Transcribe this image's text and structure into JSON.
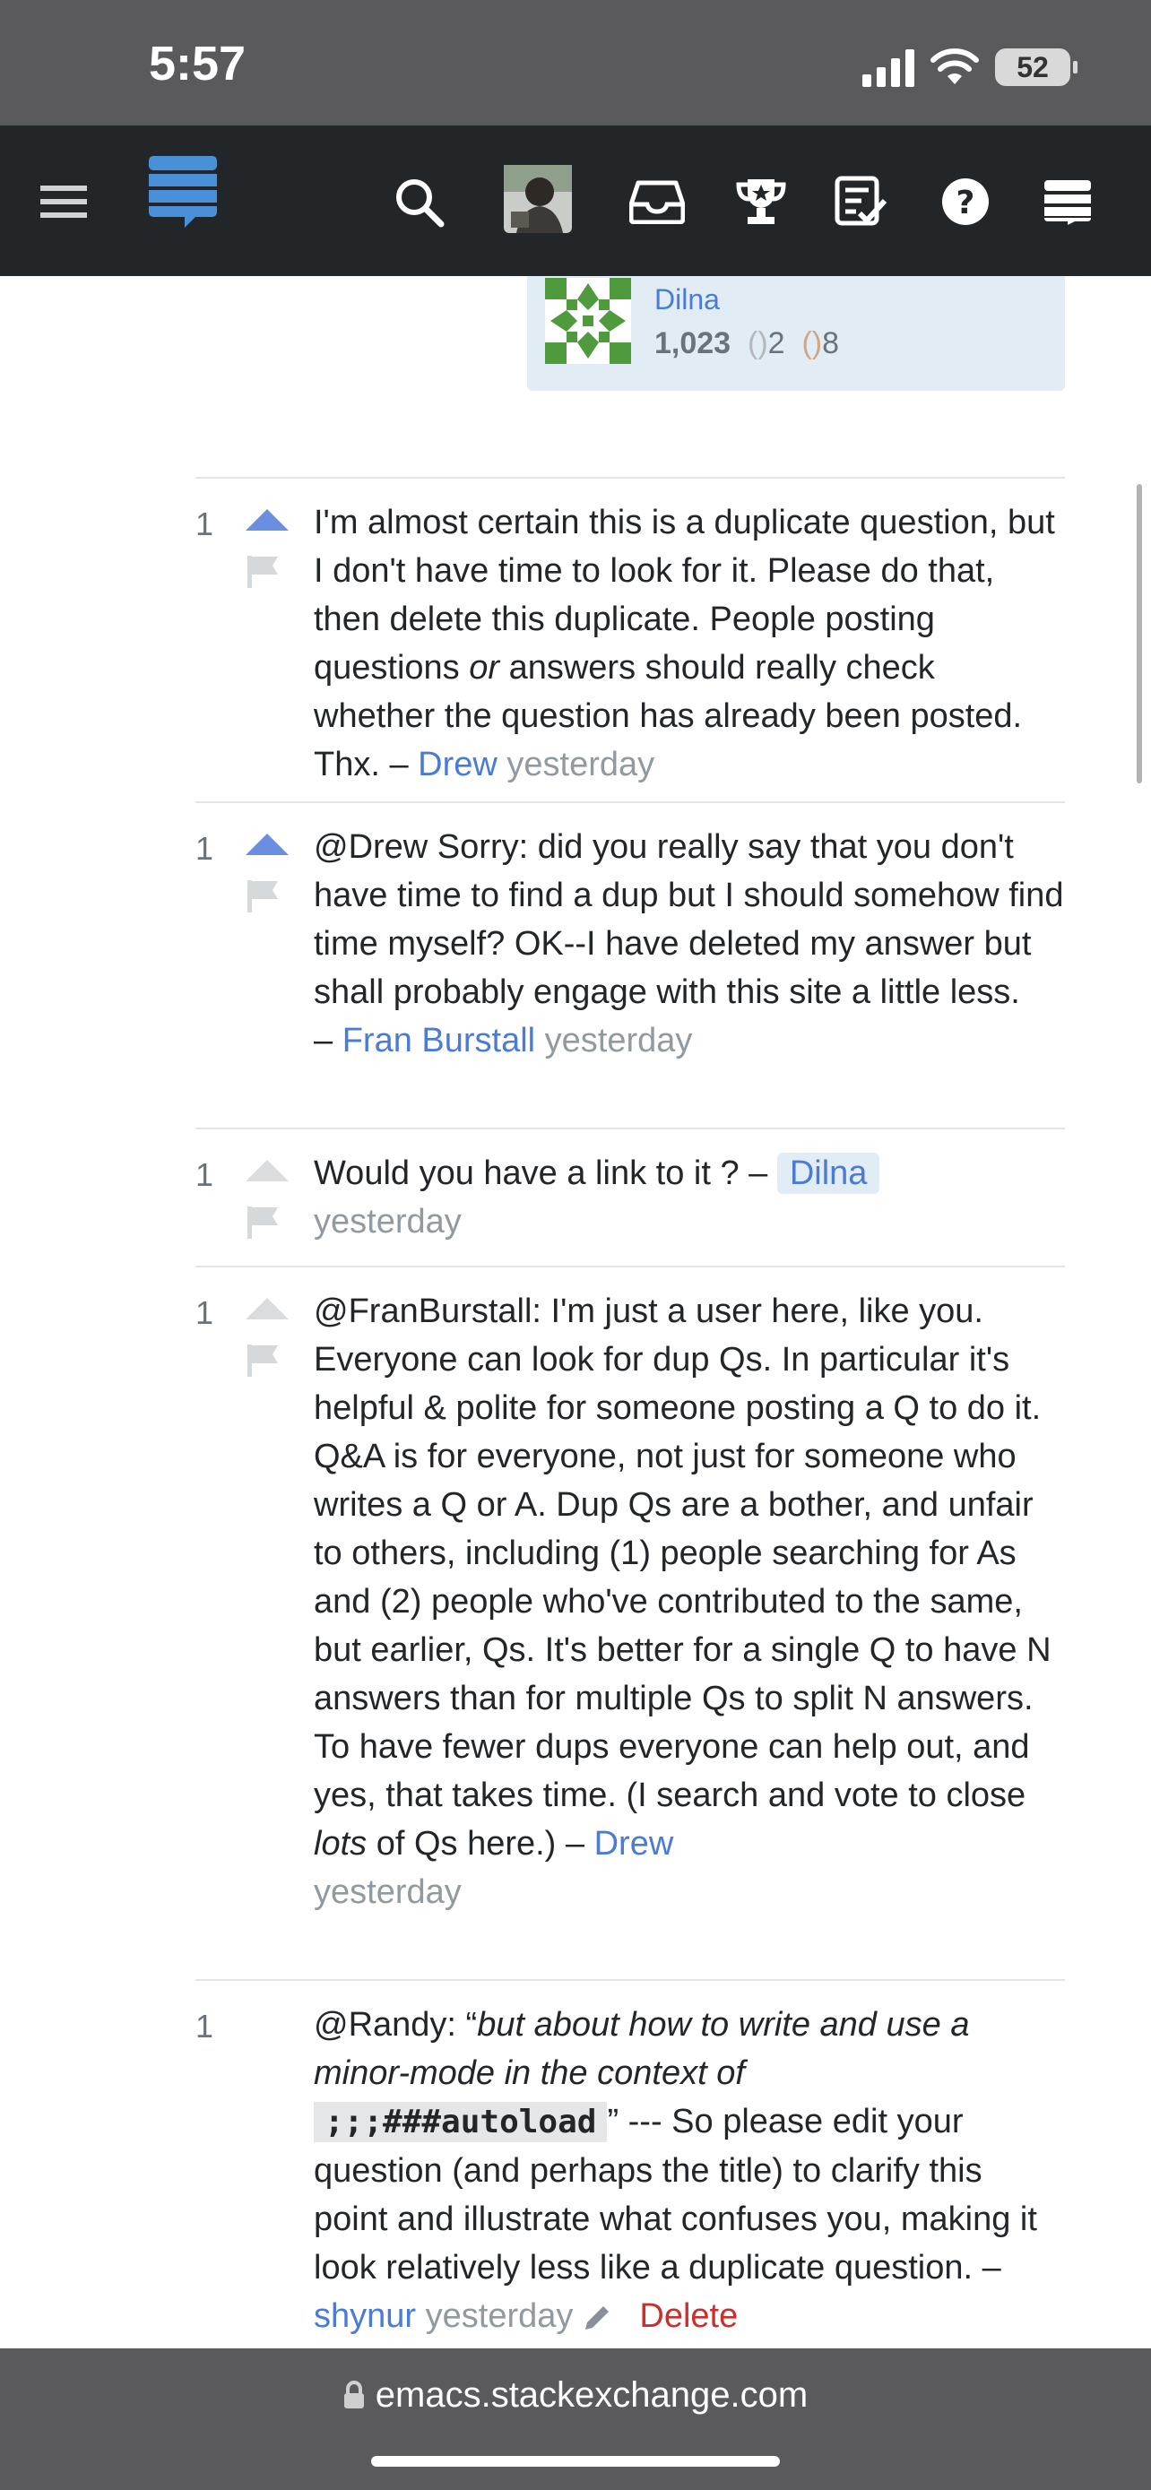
{
  "status": {
    "time": "5:57",
    "battery": "52"
  },
  "topbar": {
    "icons": [
      "menu-icon",
      "stack-exchange-logo",
      "search-icon",
      "user-avatar",
      "inbox-icon",
      "achievements-icon",
      "review-icon",
      "help-icon",
      "site-switcher-icon"
    ]
  },
  "user_card": {
    "name": "Dilna",
    "reputation": "1,023",
    "silver_badges": "2",
    "bronze_badges": "8",
    "colors": {
      "silver": "#b4b8bc",
      "bronze": "#d1a684"
    }
  },
  "comments": [
    {
      "score": "1",
      "voted": true,
      "text": "I'm almost certain this is a duplicate question, but I don't have time to look for it. Please do that, then delete this duplicate. People posting questions ",
      "em": "or",
      "text2": " answers should really check whether the question has already been posted. Thx. – ",
      "user": "Drew",
      "time": "yesterday"
    },
    {
      "score": "1",
      "voted": true,
      "text": "@Drew Sorry: did you really say that you don't have time to find a dup but I should somehow find time myself? OK--I have deleted my answer but shall probably engage with this site a little less.",
      "dash": "– ",
      "user": "Fran Burstall",
      "time": "yesterday"
    },
    {
      "score": "1",
      "voted": false,
      "text": "Would you have a link to it ? – ",
      "user": "Dilna",
      "time": "yesterday"
    },
    {
      "score": "1",
      "voted": false,
      "text": "@FranBurstall: I'm just a user here, like you. Everyone can look for dup Qs. In particular it's helpful & polite for someone posting a Q to do it. Q&A is for everyone, not just for someone who writes a Q or A. Dup Qs are a bother, and unfair to others, including (1) people searching for As and (2) people who've contributed to the same, but earlier, Qs. It's better for a single Q to have N answers than for multiple Qs to split N answers. To have fewer dups everyone can help out, and yes, that takes time. (I search and vote to close ",
      "em": "lots",
      "text2": " of Qs here.) – ",
      "user": "Drew",
      "time": "yesterday"
    },
    {
      "score": "1",
      "text_pre": "@Randy: “",
      "em": "but about how to write and use a minor-mode in the context of",
      "code": ";;;###autoload",
      "text_post": "” --- So please edit your question (and perhaps the title) to clarify this point and illustrate what confuses you, making it look relatively less like a duplicate question. – ",
      "user": "shynur",
      "time": "yesterday",
      "delete_label": "Delete"
    }
  ],
  "browser": {
    "url": "emacs.stackexchange.com"
  }
}
